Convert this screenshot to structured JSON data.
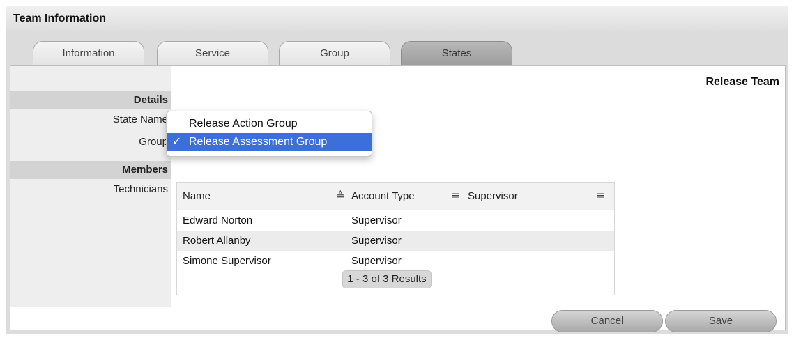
{
  "window": {
    "title": "Team Information"
  },
  "tabs": [
    {
      "label": "Information"
    },
    {
      "label": "Service"
    },
    {
      "label": "Group"
    },
    {
      "label": "States",
      "active": true
    }
  ],
  "page": {
    "title": "Release Team"
  },
  "details": {
    "section_label": "Details",
    "state_name_label": "State Name",
    "group_label": "Group"
  },
  "group_dropdown": {
    "options": [
      "Release Action Group",
      "Release Assessment Group"
    ],
    "selected": "Release Assessment Group",
    "check_glyph": "✓"
  },
  "members": {
    "section_label": "Members",
    "technicians_label": "Technicians"
  },
  "table": {
    "columns": [
      "Name",
      "Account Type",
      "Supervisor"
    ],
    "rows": [
      {
        "name": "Edward Norton",
        "account_type": "Supervisor",
        "supervisor": ""
      },
      {
        "name": "Robert Allanby",
        "account_type": "Supervisor",
        "supervisor": ""
      },
      {
        "name": "Simone Supervisor",
        "account_type": "Supervisor",
        "supervisor": ""
      }
    ],
    "pager": "1 - 3 of 3 Results"
  },
  "buttons": {
    "cancel": "Cancel",
    "save": "Save"
  },
  "icons": {
    "sort_asc": "sort-ascending-icon",
    "column_menu": "column-menu-icon"
  },
  "colors": {
    "selection": "#3b6fd9",
    "active_tab": "#a8a8a8"
  }
}
